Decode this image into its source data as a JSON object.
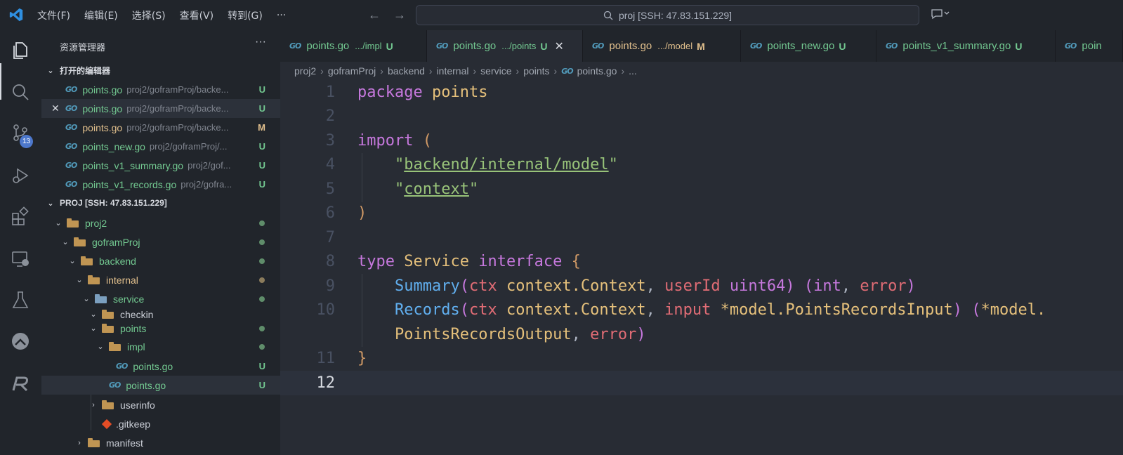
{
  "titlebar": {
    "menu": [
      "文件(F)",
      "编辑(E)",
      "选择(S)",
      "查看(V)",
      "转到(G)",
      "···"
    ],
    "search": "proj [SSH: 47.83.151.229]"
  },
  "activity": {
    "scm_badge": "13"
  },
  "sidebar": {
    "title": "资源管理器",
    "open_editors_label": "打开的编辑器",
    "open_editors": [
      {
        "name": "points.go",
        "path": "proj2/goframProj/backe...",
        "status": "U"
      },
      {
        "name": "points.go",
        "path": "proj2/goframProj/backe...",
        "status": "U"
      },
      {
        "name": "points.go",
        "path": "proj2/goframProj/backe...",
        "status": "M"
      },
      {
        "name": "points_new.go",
        "path": "proj2/goframProj/...",
        "status": "U"
      },
      {
        "name": "points_v1_summary.go",
        "path": "proj2/gof...",
        "status": "U"
      },
      {
        "name": "points_v1_records.go",
        "path": "proj2/gofra...",
        "status": "U"
      }
    ],
    "project_label": "PROJ [SSH: 47.83.151.229]",
    "tree": [
      {
        "label": "proj2"
      },
      {
        "label": "goframProj"
      },
      {
        "label": "backend"
      },
      {
        "label": "internal"
      },
      {
        "label": "service"
      },
      {
        "label": "checkin"
      },
      {
        "label": "points"
      },
      {
        "label": "impl"
      },
      {
        "label": "points.go",
        "status": "U"
      },
      {
        "label": "points.go",
        "status": "U"
      },
      {
        "label": "userinfo"
      },
      {
        "label": ".gitkeep"
      },
      {
        "label": "manifest"
      }
    ]
  },
  "tabs": [
    {
      "name": "points.go",
      "path": ".../impl",
      "status": "U"
    },
    {
      "name": "points.go",
      "path": ".../points",
      "status": "U"
    },
    {
      "name": "points.go",
      "path": ".../model",
      "status": "M"
    },
    {
      "name": "points_new.go",
      "path": "",
      "status": "U"
    },
    {
      "name": "points_v1_summary.go",
      "path": "",
      "status": "U"
    },
    {
      "name": "poin",
      "path": "",
      "status": ""
    }
  ],
  "breadcrumb": [
    "proj2",
    "goframProj",
    "backend",
    "internal",
    "service",
    "points",
    "points.go",
    "..."
  ],
  "editor": {
    "line_numbers": [
      "1",
      "2",
      "3",
      "4",
      "5",
      "6",
      "7",
      "8",
      "9",
      "10",
      "",
      "11",
      "12"
    ],
    "code": {
      "l1_kw": "package",
      "l1_name": "points",
      "l3_kw": "import",
      "l3_paren": "(",
      "l4_str": "backend/internal/model",
      "l5_str": "context",
      "l6_paren": ")",
      "l8_kw": "type",
      "l8_name": "Service",
      "l8_kw2": "interface",
      "l8_brace": "{",
      "l9_fn": "Summary",
      "l9_p1": "ctx",
      "l9_t1": "context.Context",
      "l9_p2": "userId",
      "l9_t2": "uint64",
      "l9_r1": "int",
      "l9_r2": "error",
      "l10_fn": "Records",
      "l10_p1": "ctx",
      "l10_t1": "context.Context",
      "l10_p2": "input",
      "l10_t2": "*model.PointsRecordsInput",
      "l10_r1": "*model.",
      "l10b_t": "PointsRecordsOutput",
      "l10b_r2": "error",
      "l11_brace": "}"
    }
  },
  "colors": {
    "accent_blue": "#519aba",
    "untracked_green": "#73c991",
    "modified_yellow": "#e2c08d",
    "keyword": "#c678dd",
    "type": "#e5c07b",
    "function": "#61afef",
    "string": "#98c379",
    "param": "#e06c75"
  }
}
